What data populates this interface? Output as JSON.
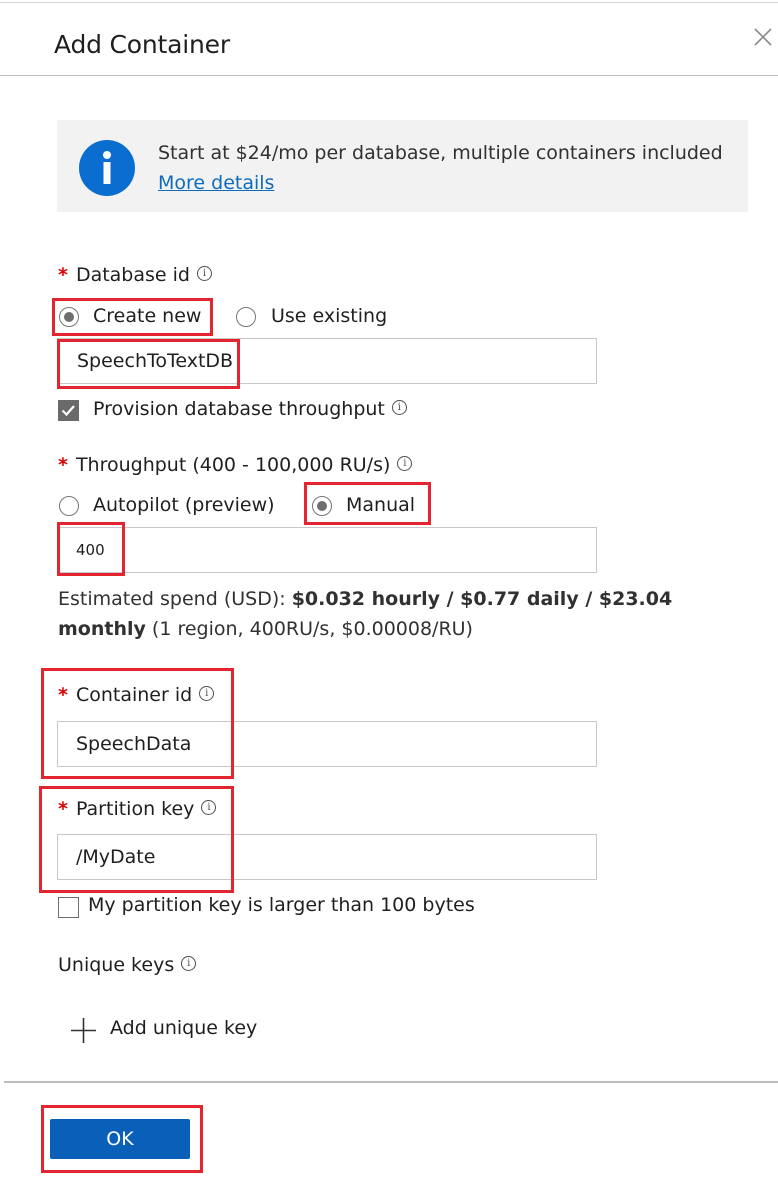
{
  "dialog": {
    "title": "Add Container",
    "close_icon": "close-icon"
  },
  "info": {
    "icon": "info-icon",
    "text": "Start at $24/mo per database, multiple containers included",
    "link": "More details"
  },
  "database": {
    "label": "Database id",
    "options": [
      "Create new",
      "Use existing"
    ],
    "selected": "Create new",
    "value": "SpeechToTextDB",
    "provision_label": "Provision database throughput",
    "provision_checked": true
  },
  "throughput": {
    "label": "Throughput (400 - 100,000 RU/s)",
    "options": [
      "Autopilot (preview)",
      "Manual"
    ],
    "selected": "Manual",
    "value": "400",
    "estimate_prefix": "Estimated spend (USD): ",
    "estimate_bold1": "$0.032 hourly / $0.77 daily / $23.04",
    "estimate_bold2": "monthly",
    "estimate_suffix": " (1 region, 400RU/s, $0.00008/RU)"
  },
  "container": {
    "label": "Container id",
    "value": "SpeechData"
  },
  "partition": {
    "label": "Partition key",
    "value": "/MyDate",
    "large_key_label": "My partition key is larger than 100 bytes",
    "large_key_checked": false
  },
  "unique_keys": {
    "label": "Unique keys",
    "add_label": "Add unique key"
  },
  "footer": {
    "ok_label": "OK"
  },
  "colors": {
    "accent": "#0a5fb8",
    "link": "#0f6cbd",
    "required": "#e00000",
    "highlight": "#e3252f",
    "info_bg": "#f2f2f2"
  }
}
